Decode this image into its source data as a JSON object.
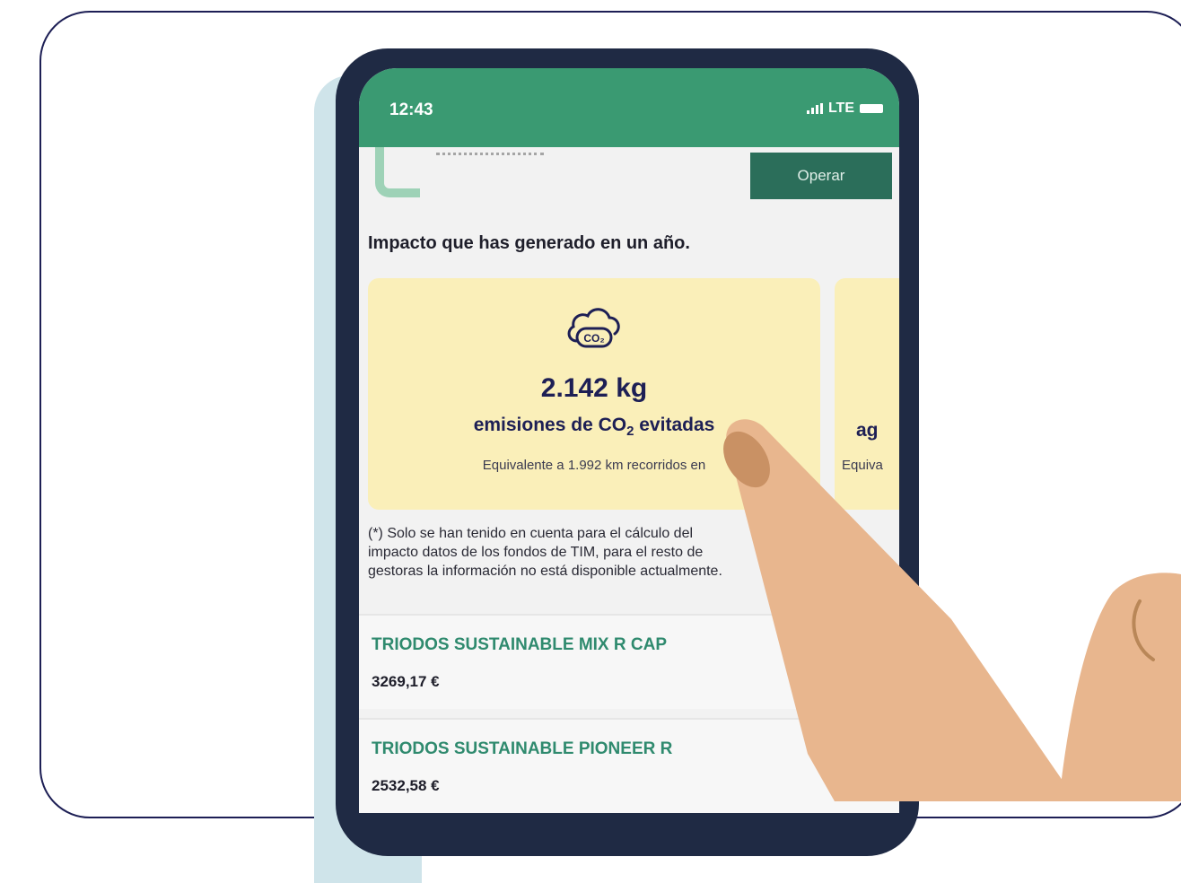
{
  "status_bar": {
    "time": "12:43",
    "network": "LTE"
  },
  "header": {
    "operar_label": "Operar"
  },
  "impact": {
    "title": "Impacto que has generado en un año.",
    "card": {
      "icon_label": "CO₂",
      "value": "2.142 kg",
      "description_pre": "emisiones de CO",
      "description_sub": "2",
      "description_post": " evitadas",
      "equivalent": "Equivalente a 1.992 km recorridos en"
    },
    "card2": {
      "partial_label": "ag",
      "partial_equiv": "Equiva"
    }
  },
  "note": {
    "lines": [
      "(*) Solo se han tenido en cuenta para el cálculo del",
      "impacto datos de los fondos de TIM, para el resto de",
      "gestoras la información no está disponible actualmente."
    ]
  },
  "funds": [
    {
      "name": "TRIODOS SUSTAINABLE MIX R CAP",
      "amount": "3269,17 €"
    },
    {
      "name": "TRIODOS SUSTAINABLE PIONEER R",
      "amount": "2532,58 €"
    }
  ],
  "colors": {
    "accent_green": "#3a9a72",
    "button_green": "#2b6e5a",
    "fund_name_green": "#2f8a6e",
    "card_yellow": "#faefb9",
    "navy": "#1d1f55",
    "skin": "#e8b68e"
  }
}
